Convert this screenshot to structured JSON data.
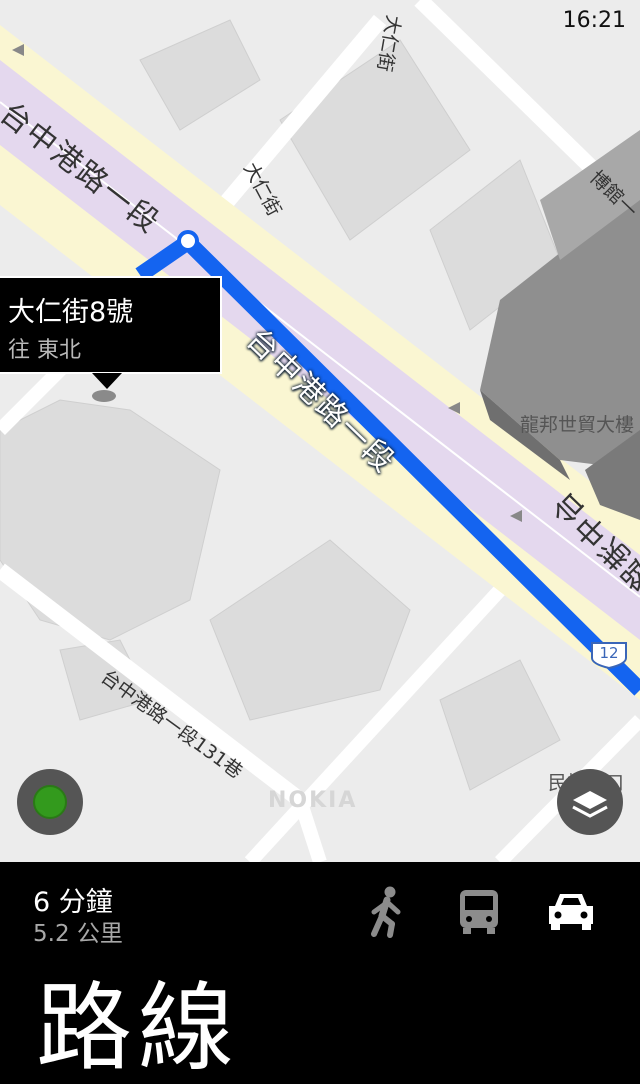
{
  "status_bar": {
    "time": "16:21"
  },
  "map": {
    "road_labels": {
      "main_road_top": "台中港路一段",
      "main_road_route": "台中港路一段",
      "main_road_right": "台中港路",
      "dairen_st_top": "大仁街",
      "dairen_st_mid": "大仁街",
      "bowu_st": "博館一",
      "lane_131": "台中港路一段131巷"
    },
    "poi_labels": {
      "longbang": "龍邦世貿大樓",
      "minquan": "民權路口"
    },
    "highway_shield": "12",
    "watermark": "NOKIA",
    "popup": {
      "title": "大仁街8號",
      "subtitle": "往 東北"
    },
    "route_color": "#1464f0",
    "locate_icon": "current-location-icon",
    "layers_icon": "map-layers-icon"
  },
  "route_summary": {
    "duration": "6 分鐘",
    "distance": "5.2 公里",
    "modes": [
      {
        "name": "walk",
        "icon": "walking-person-icon",
        "selected": false
      },
      {
        "name": "transit",
        "icon": "bus-icon",
        "selected": false
      },
      {
        "name": "drive",
        "icon": "car-icon",
        "selected": true
      }
    ]
  },
  "page_title": "路線"
}
